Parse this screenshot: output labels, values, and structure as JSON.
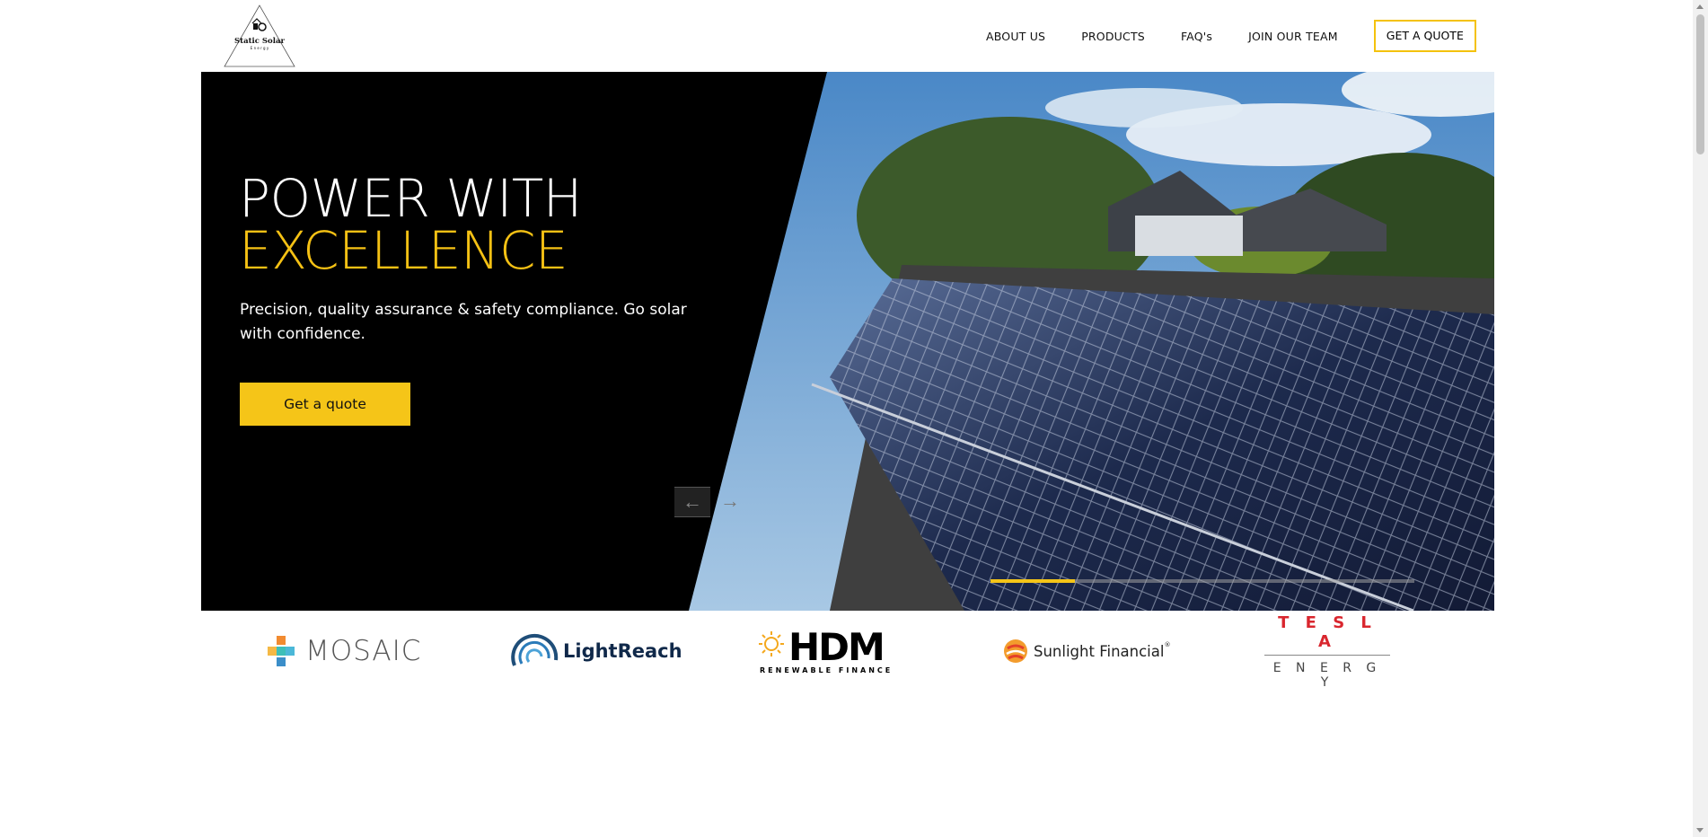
{
  "brand": {
    "logo_line1": "Static Solar",
    "logo_line2": "E n e r g y"
  },
  "nav": {
    "items": [
      "ABOUT US",
      "PRODUCTS",
      "FAQ's",
      "JOIN OUR TEAM"
    ],
    "quote_label": "GET A QUOTE"
  },
  "hero": {
    "headline_line1": "POWER WITH",
    "headline_line2": "EXCELLENCE",
    "subtitle": "Precision, quality assurance & safety compliance. Go solar with confidence.",
    "cta_label": "Get a quote",
    "slide_progress": 0.2,
    "accent_color": "#f5c518"
  },
  "partners": {
    "mosaic": "MOSAIC",
    "lightreach": "LightReach",
    "hdm": "HDM",
    "hdm_sub": "RENEWABLE FINANCE",
    "sunlight": "Sunlight Financial",
    "sunlight_mark": "®",
    "tesla": "T E S L A",
    "tesla_sub": "E N E R G Y"
  }
}
